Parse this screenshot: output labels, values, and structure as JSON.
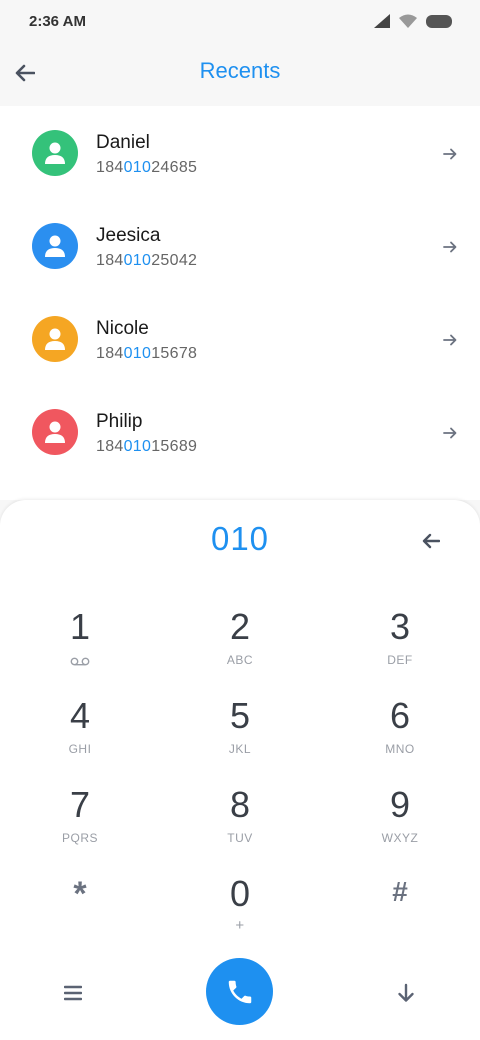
{
  "status_bar": {
    "time": "2:36 AM"
  },
  "header": {
    "title": "Recents"
  },
  "recents": [
    {
      "name": "Daniel",
      "number_prefix": "184",
      "number_match": "010",
      "number_suffix": "24685",
      "avatar_color": "#34c27a"
    },
    {
      "name": "Jeesica",
      "number_prefix": "184",
      "number_match": "010",
      "number_suffix": "25042",
      "avatar_color": "#2b8ff0"
    },
    {
      "name": "Nicole",
      "number_prefix": "184",
      "number_match": "010",
      "number_suffix": "15678",
      "avatar_color": "#f5a623"
    },
    {
      "name": "Philip",
      "number_prefix": "184",
      "number_match": "010",
      "number_suffix": "15689",
      "avatar_color": "#f0575f"
    }
  ],
  "dialpad": {
    "entry": "010",
    "keys": [
      {
        "digit": "1",
        "letters": ""
      },
      {
        "digit": "2",
        "letters": "ABC"
      },
      {
        "digit": "3",
        "letters": "DEF"
      },
      {
        "digit": "4",
        "letters": "GHI"
      },
      {
        "digit": "5",
        "letters": "JKL"
      },
      {
        "digit": "6",
        "letters": "MNO"
      },
      {
        "digit": "7",
        "letters": "PQRS"
      },
      {
        "digit": "8",
        "letters": "TUV"
      },
      {
        "digit": "9",
        "letters": "WXYZ"
      },
      {
        "digit": "*",
        "letters": ""
      },
      {
        "digit": "0",
        "letters": "+"
      },
      {
        "digit": "#",
        "letters": ""
      }
    ]
  },
  "colors": {
    "accent": "#1e90f0",
    "icon_gray": "#6b7280"
  },
  "icons": {
    "status": [
      "cellular-signal-icon",
      "wifi-icon",
      "battery-icon"
    ],
    "back": "back-arrow-icon",
    "row": "arrow-right-icon",
    "delete": "backspace-arrow-icon",
    "menu": "menu-icon",
    "call": "phone-icon",
    "collapse": "arrow-down-icon",
    "voicemail": "voicemail-icon"
  }
}
